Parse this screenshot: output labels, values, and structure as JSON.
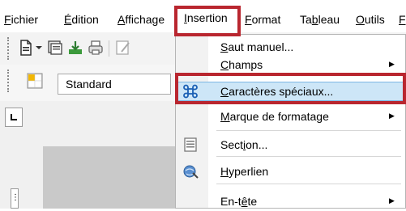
{
  "menubar": {
    "items": [
      {
        "pre": "",
        "mn": "F",
        "post": "ichier"
      },
      {
        "pre": "",
        "mn": "É",
        "post": "dition"
      },
      {
        "pre": "",
        "mn": "A",
        "post": "ffichage"
      },
      {
        "pre": "",
        "mn": "I",
        "post": "nsertion"
      },
      {
        "pre": "",
        "mn": "F",
        "post": "ormat"
      },
      {
        "pre": "Ta",
        "mn": "b",
        "post": "leau"
      },
      {
        "pre": "",
        "mn": "O",
        "post": "utils"
      },
      {
        "pre": "",
        "mn": "F",
        "post": ""
      }
    ]
  },
  "toolbar": {
    "style_value": "Standard"
  },
  "dropdown": {
    "items": [
      {
        "pre": "",
        "mn": "S",
        "post": "aut manuel..."
      },
      {
        "pre": "",
        "mn": "C",
        "post": "hamps"
      },
      {
        "pre": "",
        "mn": "C",
        "post": "aractères spéciaux..."
      },
      {
        "pre": "",
        "mn": "M",
        "post": "arque de formatage"
      },
      {
        "pre": "Sect",
        "mn": "i",
        "post": "on..."
      },
      {
        "pre": "",
        "mn": "H",
        "post": "yperlien"
      },
      {
        "pre": "En-t",
        "mn": "ê",
        "post": "te"
      }
    ]
  },
  "icons": {
    "new_doc": "new-document-icon",
    "dropdown_arrow": "dropdown-arrow-icon",
    "template": "template-icon",
    "save": "save-icon",
    "print": "print-icon",
    "edit": "edit-icon",
    "styles": "styles-icon",
    "special_chars": "command-symbol-icon",
    "section": "section-icon",
    "hyperlink": "hyperlink-icon"
  },
  "colors": {
    "highlight_border": "#b9262f",
    "menu_hover": "#cde6f7"
  }
}
